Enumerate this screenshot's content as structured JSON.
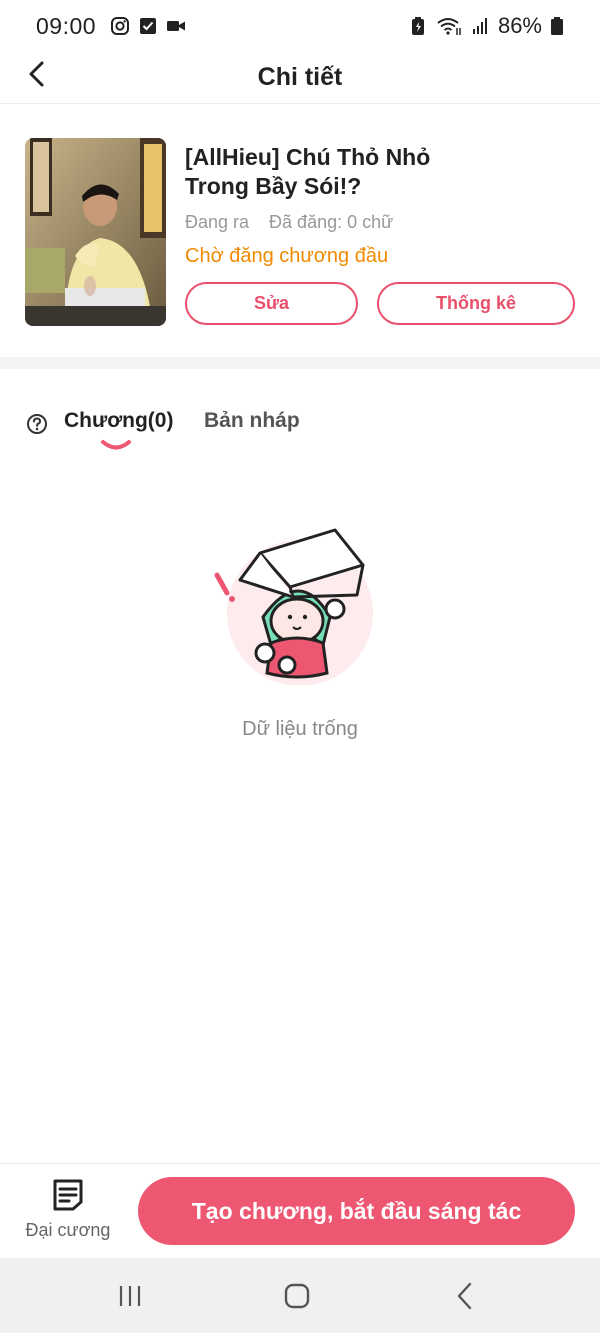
{
  "status_bar": {
    "time": "09:00",
    "battery_percent": "86%"
  },
  "header": {
    "title": "Chi tiết"
  },
  "book": {
    "title": "[AllHieu] Chú Thỏ Nhỏ Trong Bầy Sói!?",
    "state": "Đang ra",
    "words_posted": "Đã đăng: 0 chữ",
    "status": "Chờ đăng chương đầu",
    "edit_label": "Sửa",
    "stats_label": "Thống kê"
  },
  "tabs": [
    {
      "label": "Chương(0)",
      "active": true
    },
    {
      "label": "Bản nháp",
      "active": false
    }
  ],
  "empty_state": {
    "text": "Dữ liệu trống"
  },
  "bottom_bar": {
    "outline_label": "Đại cương",
    "create_label": "Tạo chương, bắt đầu sáng tác"
  },
  "colors": {
    "accent": "#ee5771",
    "status_orange": "#f08a00"
  },
  "icons": [
    "instagram-icon",
    "checkbox-icon",
    "video-icon",
    "wifi-icon",
    "signal-icon",
    "battery-icon",
    "back-icon",
    "help-icon",
    "outline-doc-icon"
  ]
}
